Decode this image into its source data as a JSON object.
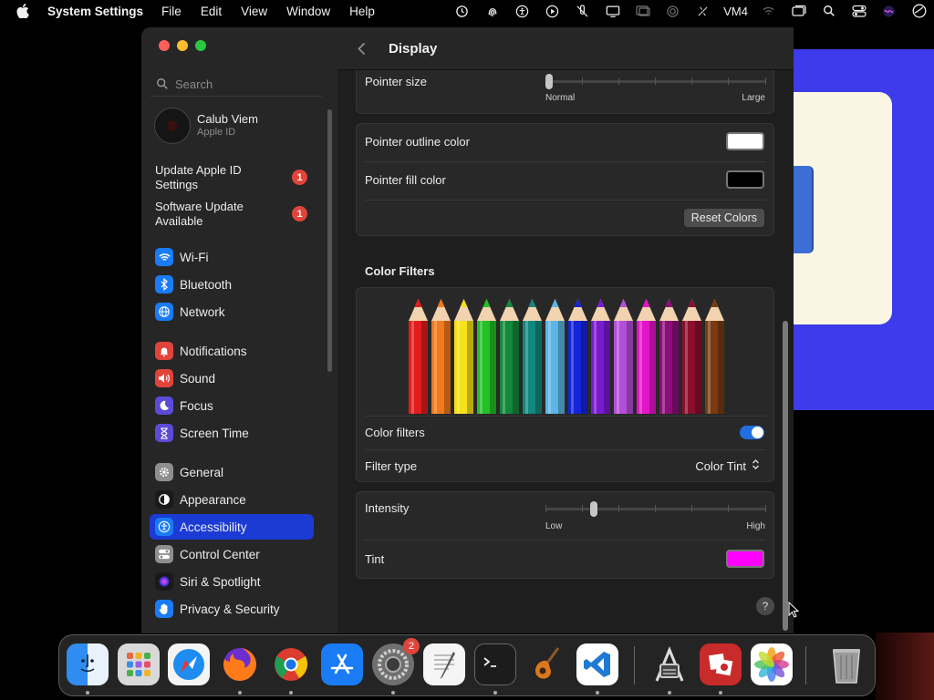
{
  "menubar": {
    "app_name": "System Settings",
    "menus": [
      "File",
      "Edit",
      "View",
      "Window",
      "Help"
    ],
    "status_text": "VM4"
  },
  "sidebar": {
    "search_placeholder": "Search",
    "account": {
      "name": "Calub Viem",
      "subtitle": "Apple ID"
    },
    "notices": [
      {
        "label": "Update Apple ID Settings",
        "badge": "1"
      },
      {
        "label": "Software Update Available",
        "badge": "1"
      }
    ],
    "items": [
      {
        "label": "Wi-Fi",
        "icon": "wifi-icon",
        "color": "#1a7cf5"
      },
      {
        "label": "Bluetooth",
        "icon": "bluetooth-icon",
        "color": "#1a7cf5"
      },
      {
        "label": "Network",
        "icon": "globe-icon",
        "color": "#1a7cf5"
      },
      {
        "label": "Notifications",
        "icon": "bell-icon",
        "color": "#e0443b"
      },
      {
        "label": "Sound",
        "icon": "speaker-icon",
        "color": "#e0443b"
      },
      {
        "label": "Focus",
        "icon": "moon-icon",
        "color": "#5b4bd6"
      },
      {
        "label": "Screen Time",
        "icon": "hourglass-icon",
        "color": "#5b4bd6"
      },
      {
        "label": "General",
        "icon": "gear-icon",
        "color": "#8e8e8e"
      },
      {
        "label": "Appearance",
        "icon": "appearance-icon",
        "color": "#1a1a1a"
      },
      {
        "label": "Accessibility",
        "icon": "accessibility-icon",
        "color": "#1a7cf5"
      },
      {
        "label": "Control Center",
        "icon": "toggles-icon",
        "color": "#8e8e8e"
      },
      {
        "label": "Siri & Spotlight",
        "icon": "siri-icon",
        "color": "#1a1a1a"
      },
      {
        "label": "Privacy & Security",
        "icon": "hand-icon",
        "color": "#1a7cf5"
      }
    ],
    "active_item": "Accessibility"
  },
  "content": {
    "title": "Display",
    "pointer_size": {
      "label": "Pointer size",
      "min_label": "Normal",
      "max_label": "Large",
      "value": 0.0
    },
    "pointer_outline": {
      "label": "Pointer outline color",
      "color": "#ffffff"
    },
    "pointer_fill": {
      "label": "Pointer fill color",
      "color": "#000000"
    },
    "reset_button": "Reset Colors",
    "color_filters_section": "Color Filters",
    "color_filters_toggle": {
      "label": "Color filters",
      "on": true
    },
    "filter_type": {
      "label": "Filter type",
      "value": "Color Tint"
    },
    "intensity": {
      "label": "Intensity",
      "min_label": "Low",
      "max_label": "High",
      "value": 0.21
    },
    "tint": {
      "label": "Tint",
      "color": "#ff00ff"
    },
    "help": "?"
  },
  "dock": {
    "items": [
      {
        "name": "Finder",
        "icon": "finder-icon"
      },
      {
        "name": "Launchpad",
        "icon": "launchpad-icon"
      },
      {
        "name": "Safari",
        "icon": "safari-icon"
      },
      {
        "name": "Firefox",
        "icon": "firefox-icon"
      },
      {
        "name": "Chrome",
        "icon": "chrome-icon"
      },
      {
        "name": "App Store",
        "icon": "app-store-icon"
      },
      {
        "name": "System Settings",
        "icon": "system-settings-icon",
        "badge": "2"
      },
      {
        "name": "TextEdit",
        "icon": "textedit-icon"
      },
      {
        "name": "Terminal",
        "icon": "terminal-icon"
      },
      {
        "name": "GarageBand",
        "icon": "garageband-icon"
      },
      {
        "name": "Visual Studio Code",
        "icon": "vscode-icon"
      },
      {
        "name": "System Information",
        "icon": "system-information-icon"
      },
      {
        "name": "Photo Booth",
        "icon": "photo-booth-icon"
      },
      {
        "name": "Photos",
        "icon": "photos-icon"
      },
      {
        "name": "Trash",
        "icon": "trash-icon"
      }
    ]
  }
}
